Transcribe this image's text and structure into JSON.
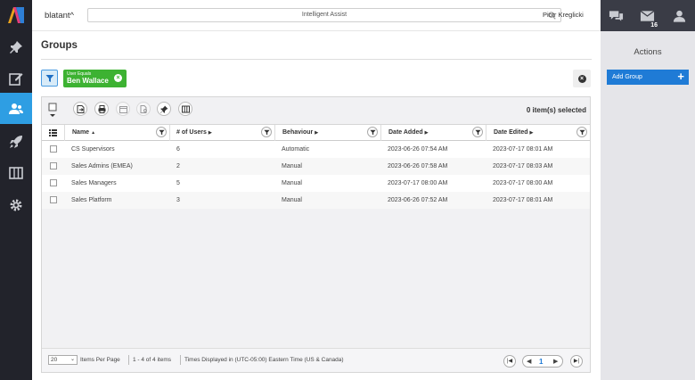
{
  "app": {
    "brand": "blatant^",
    "search_value": "Intelligent Assist",
    "user_name": "Piotr Kreglicki"
  },
  "topright": {
    "mail_badge": "16"
  },
  "page": {
    "title": "Groups"
  },
  "filter_chip": {
    "key": "User Equals",
    "value": "Ben Wallace"
  },
  "toolbar": {
    "selected_text": "0 item(s) selected"
  },
  "columns": [
    {
      "label": "Name",
      "sort": "▲"
    },
    {
      "label": "# of Users",
      "sort": "▶"
    },
    {
      "label": "Behaviour",
      "sort": "▶"
    },
    {
      "label": "Date Added",
      "sort": "▶"
    },
    {
      "label": "Date Edited",
      "sort": "▶"
    }
  ],
  "rows": [
    {
      "name": "CS Supervisors",
      "users": "6",
      "behaviour": "Automatic",
      "added": "2023-06-26 07:54 AM",
      "edited": "2023-07-17 08:01 AM"
    },
    {
      "name": "Sales Admins (EMEA)",
      "users": "2",
      "behaviour": "Manual",
      "added": "2023-06-26 07:58 AM",
      "edited": "2023-07-17 08:03 AM"
    },
    {
      "name": "Sales Managers",
      "users": "5",
      "behaviour": "Manual",
      "added": "2023-07-17 08:00 AM",
      "edited": "2023-07-17 08:00 AM"
    },
    {
      "name": "Sales Platform",
      "users": "3",
      "behaviour": "Manual",
      "added": "2023-06-26 07:52 AM",
      "edited": "2023-07-17 08:01 AM"
    }
  ],
  "pager": {
    "page_size": "20",
    "items_per_page": "Items Per Page",
    "range": "1 - 4 of 4 items",
    "timezone": "Times Displayed in (UTC-05:00) Eastern Time (US & Canada)",
    "current_page": "1"
  },
  "actions": {
    "title": "Actions",
    "add_group": "Add Group"
  }
}
